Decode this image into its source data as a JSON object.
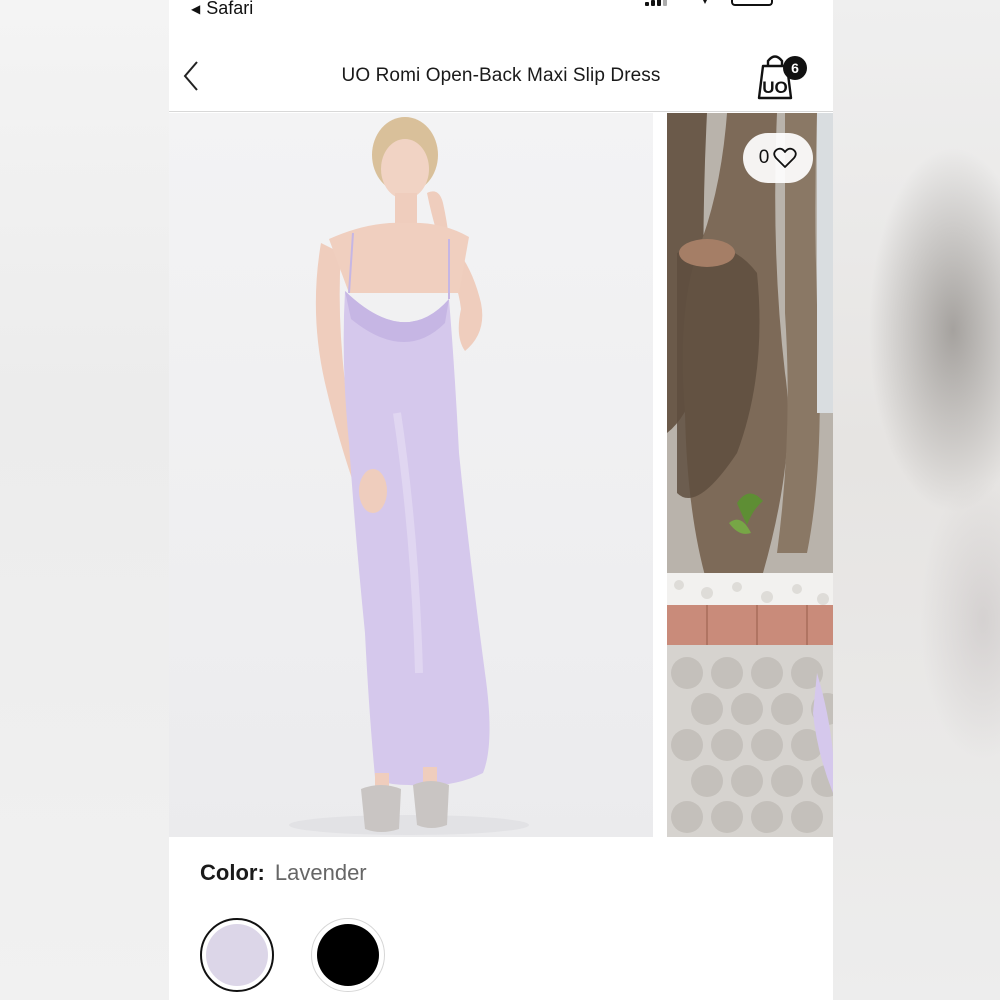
{
  "status_bar": {
    "back_app_label": "Safari",
    "back_app_icon": "triangle-left-icon"
  },
  "nav": {
    "title": "UO Romi Open-Back Maxi Slip Dress",
    "back_icon": "chevron-left-icon",
    "bag_logo": "UO",
    "bag_count": "6"
  },
  "gallery": {
    "wishlist_count": "0",
    "wishlist_icon": "heart-outline-icon"
  },
  "color": {
    "label": "Color:",
    "selected_value": "Lavender",
    "swatches": [
      {
        "name": "Lavender",
        "hex": "#dcd6e8",
        "selected": true
      },
      {
        "name": "Black",
        "hex": "#000000",
        "selected": false
      }
    ]
  },
  "colors": {
    "dress": "#d5c8ec",
    "text": "#1a1a1a",
    "muted_text": "#666666"
  }
}
